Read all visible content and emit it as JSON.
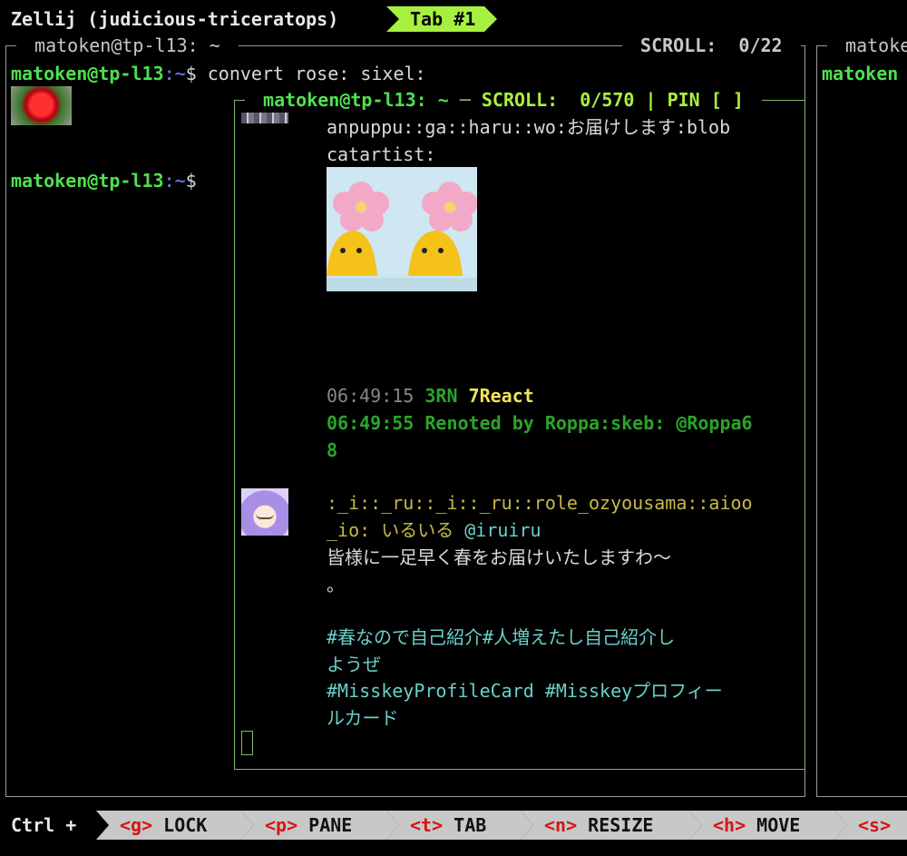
{
  "app": {
    "title": "Zellij (judicious-triceratops)",
    "active_tab": "Tab #1"
  },
  "left_pane": {
    "title": " matoken@tp-l13: ~ ",
    "scroll": " SCROLL:  0/22 ",
    "prompt_user": "matoken@tp-l13",
    "prompt_path": ":~",
    "prompt_sym": "$",
    "command": " convert rose: sixel:"
  },
  "right_pane": {
    "title_partial": " matoke",
    "prompt_partial": "matoken"
  },
  "floating_pane": {
    "title": " matoken@tp-l13: ~ ",
    "dash": "─",
    "scroll_label": " SCROLL:  0/570 | PIN [ ] ",
    "note1_text": "anpuppu::ga::haru::wo:お届けします:blob",
    "note1_text2": "catartist:",
    "time1": "06:49:15",
    "rn_count": "3RN",
    "react_count": "7React",
    "renote_line1": "06:49:55 Renoted by Roppa:skeb: @Roppa6",
    "renote_line2": "8",
    "user_line1": ":_i::_ru::_i::_ru::role_ozyousama::aioo",
    "user_line2_a": "_io: いるいる",
    "user_line2_b": " @iruiru",
    "body1": "皆様に一足早く春をお届けいたしますわ〜",
    "body2": "。",
    "tags1": "#春なので自己紹介#人増えたし自己紹介し",
    "tags2": "ようぜ",
    "tags3": "#MisskeyProfileCard #Misskeyプロフィー",
    "tags4": "ルカード"
  },
  "statusbar": {
    "prefix": "Ctrl +",
    "keys": [
      {
        "key": "<g>",
        "label": " LOCK"
      },
      {
        "key": "<p>",
        "label": " PANE"
      },
      {
        "key": "<t>",
        "label": " TAB"
      },
      {
        "key": "<n>",
        "label": " RESIZE"
      },
      {
        "key": "<h>",
        "label": " MOVE"
      },
      {
        "key": "<s>",
        "label": ""
      }
    ]
  }
}
